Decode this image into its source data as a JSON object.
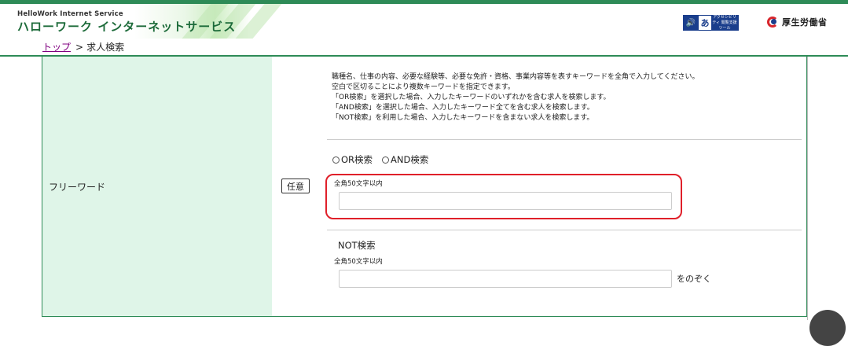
{
  "header": {
    "brand_en": "HelloWork Internet Service",
    "brand_jp": "ハローワーク インターネットサービス",
    "accessibility_tool_label": "アクセシビリティ 閲覧支援ツール",
    "accessibility_glyph": "あ",
    "ministry_name": "厚生労働省",
    "brand_color": "#2e8b57"
  },
  "breadcrumb": {
    "home": "トップ",
    "separator": ">",
    "current": "求人検索"
  },
  "form": {
    "label": "フリーワード",
    "badge": "任意",
    "description": [
      "職種名、仕事の内容、必要な経験等、必要な免許・資格、事業内容等を表すキーワードを全角で入力してください。",
      "空白で区切ることにより複数キーワードを指定できます。",
      "「OR検索」を選択した場合、入力したキーワードのいずれかを含む求人を検索します。",
      "「AND検索」を選択した場合、入力したキーワード全てを含む求人を検索します。",
      "「NOT検索」を利用した場合、入力したキーワードを含まない求人を検索します。"
    ],
    "radio_or": "OR検索",
    "radio_and": "AND検索",
    "keyword_caption": "全角50文字以内",
    "keyword_value": "",
    "not_title": "NOT検索",
    "not_caption": "全角50文字以内",
    "not_value": "",
    "not_suffix": "をのぞく",
    "highlight_color": "#e0202a",
    "label_bg": "#dff5e8"
  }
}
